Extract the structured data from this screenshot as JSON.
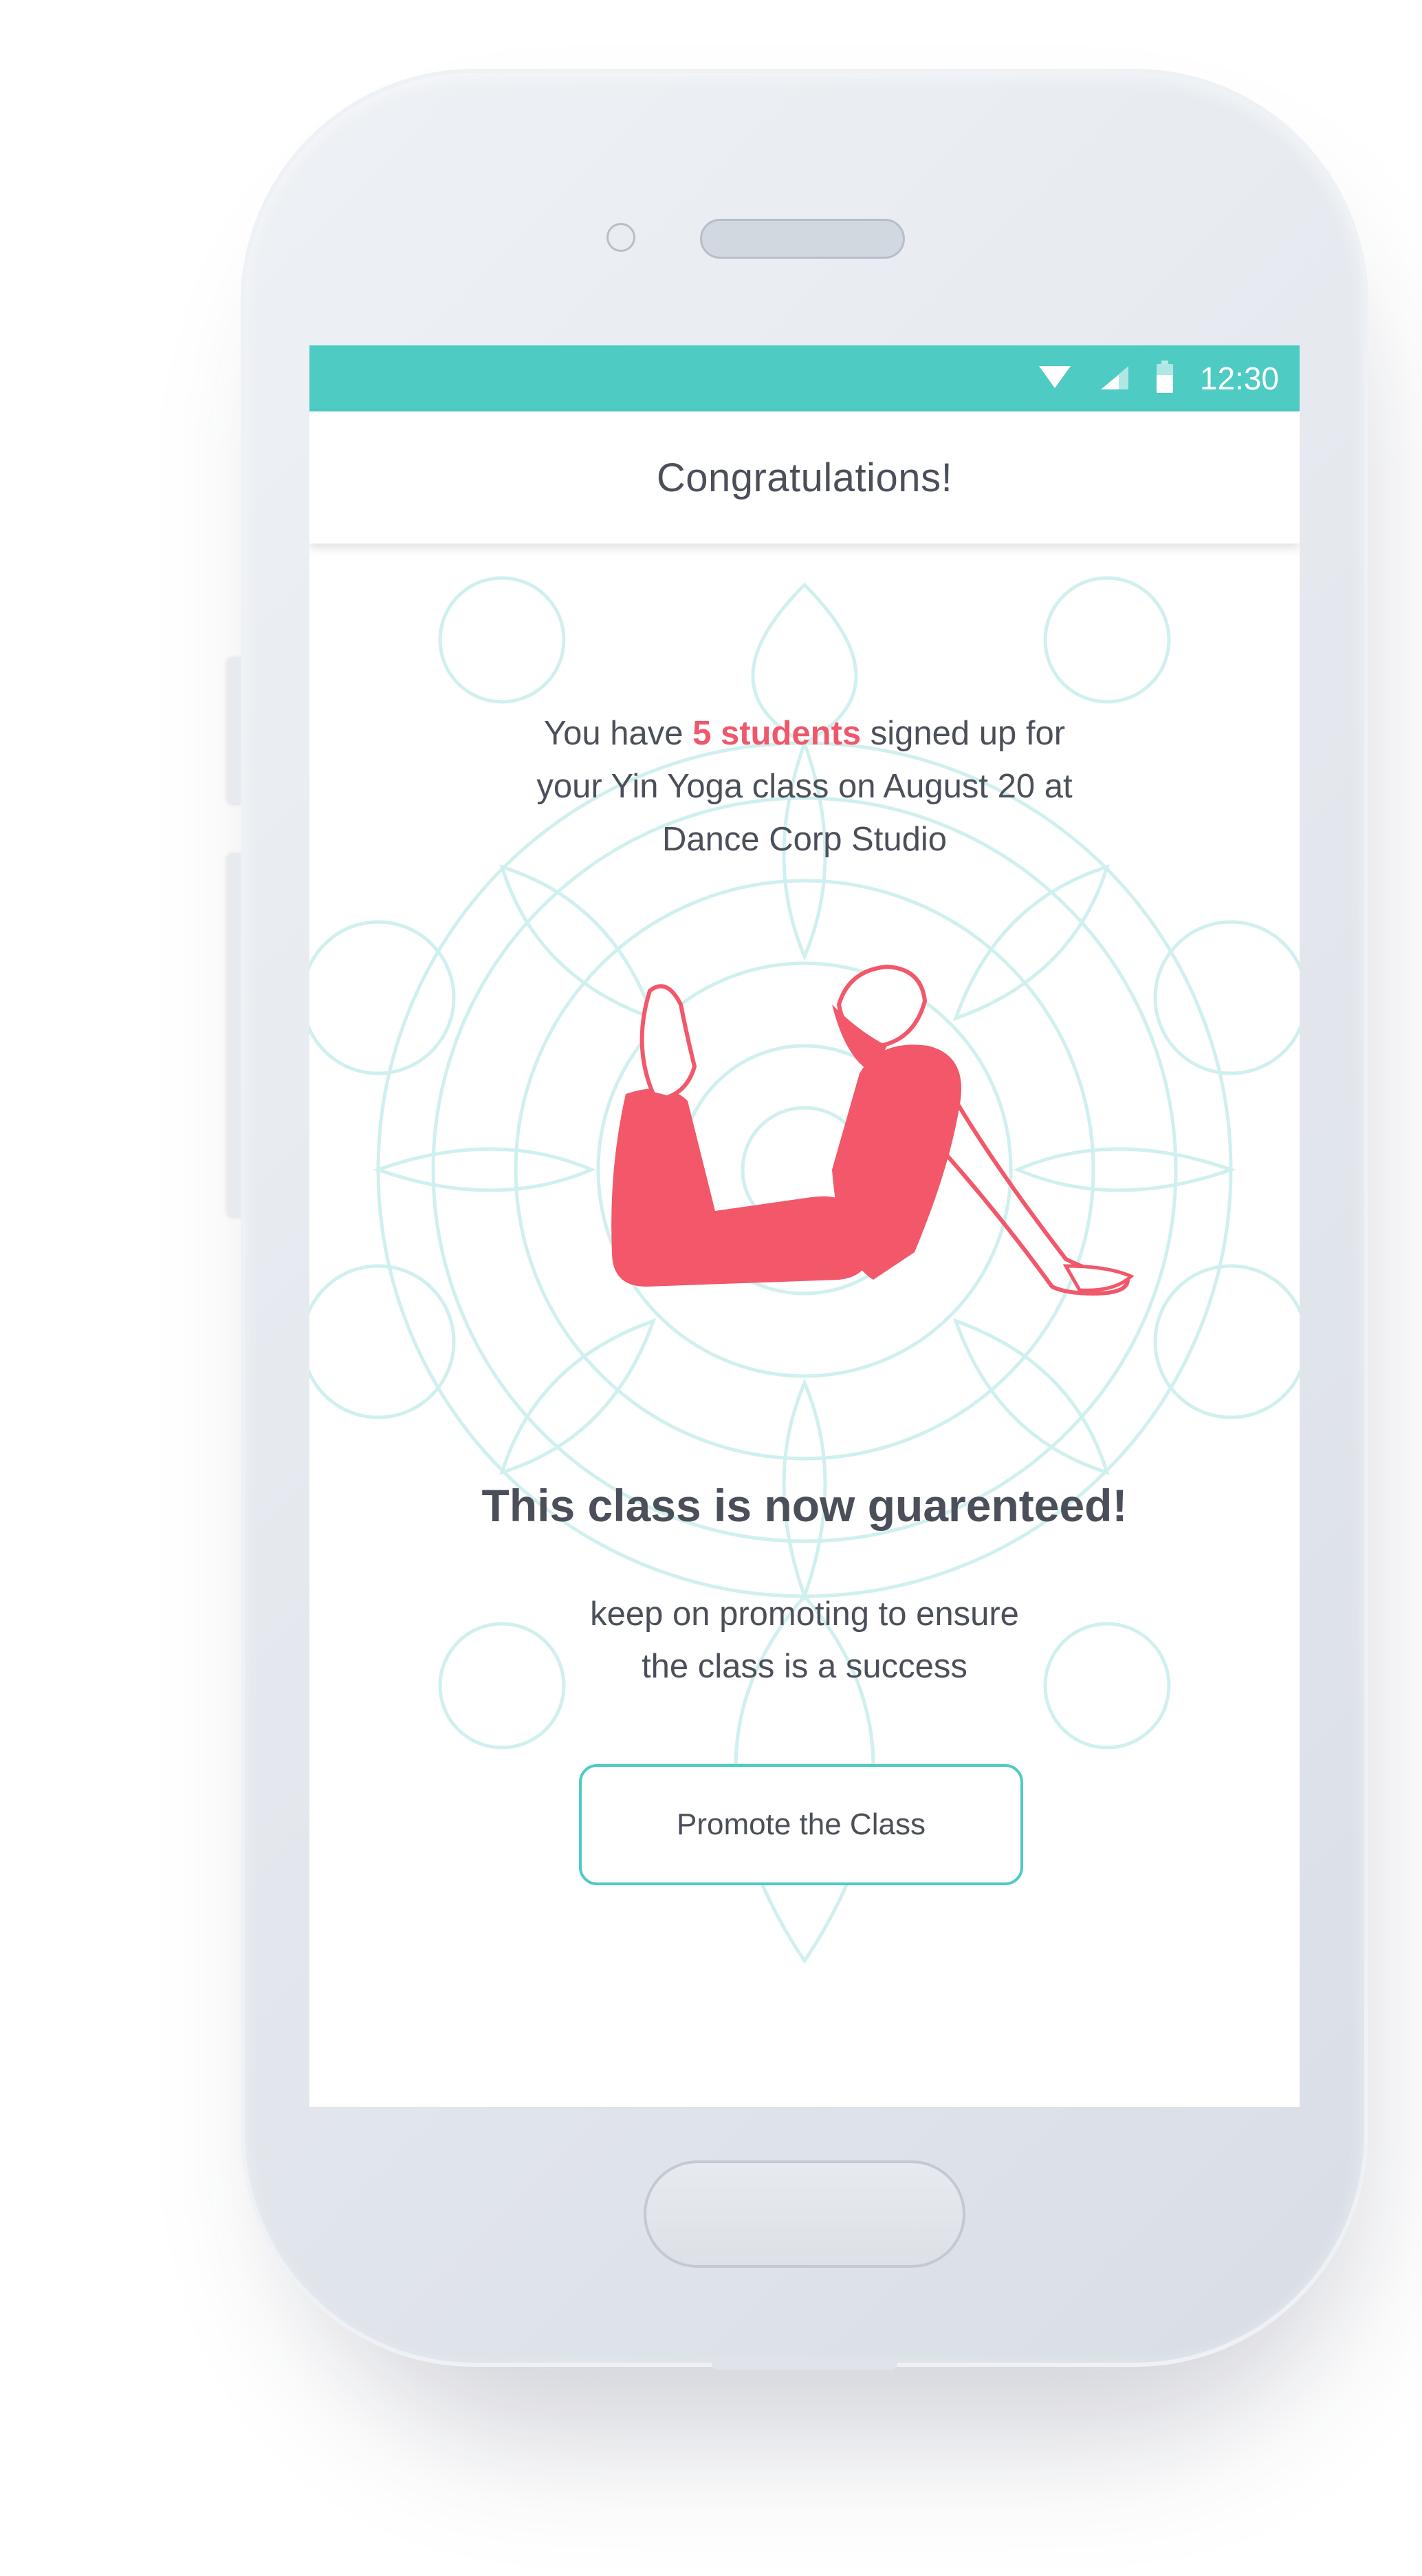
{
  "status_bar": {
    "time": "12:30",
    "background": "#4ecbc3",
    "icons": [
      "wifi-icon",
      "cell-signal-icon",
      "battery-icon"
    ]
  },
  "header": {
    "title": "Congratulations!"
  },
  "message": {
    "prefix": "You have ",
    "highlight": "5 students",
    "line1_suffix": " signed up for",
    "line2": "your Yin Yoga class on August 20 at",
    "line3": "Dance Corp Studio",
    "highlight_color": "#f0576a"
  },
  "headline": "This class is now guarenteed!",
  "subtext": {
    "line1": "keep on promoting to ensure",
    "line2": "the class is a success"
  },
  "primary_action": {
    "label": "Promote the Class",
    "border_color": "#4ecbc3"
  },
  "illustration": {
    "name": "yoga-pose-illustration",
    "color": "#f2576a"
  }
}
